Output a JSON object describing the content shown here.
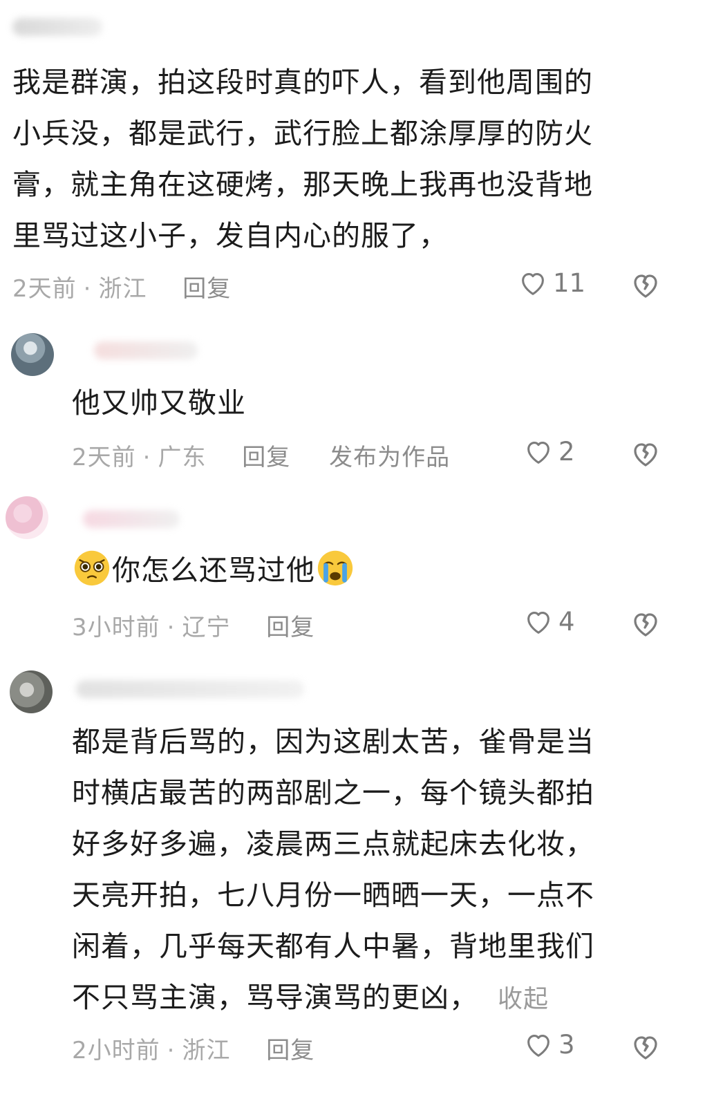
{
  "comments": [
    {
      "lines": [
        "我是群演，拍这段时真的吓人，看到他周围的",
        "小兵没，都是武行，武行脸上都涂厚厚的防火",
        "膏，就主角在这硬烤，那天晚上我再也没背地",
        "里骂过这小子，发自内心的服了，"
      ],
      "time": "2天前",
      "location": "浙江",
      "reply": "回复",
      "likes": "11"
    },
    {
      "text": "他又帅又敬业",
      "time": "2天前",
      "location": "广东",
      "reply": "回复",
      "publish": "发布为作品",
      "likes": "2"
    },
    {
      "text": "你怎么还骂过他",
      "leading_emoji": "pleading-face-emoji",
      "trailing_emoji": "crying-face-emoji",
      "time": "3小时前",
      "location": "辽宁",
      "reply": "回复",
      "likes": "4"
    },
    {
      "lines": [
        "都是背后骂的，因为这剧太苦，雀骨是当",
        "时横店最苦的两部剧之一，每个镜头都拍",
        "好多好多遍，凌晨两三点就起床去化妆，",
        "天亮开拍，七八月份一晒晒一天，一点不",
        "闲着，几乎每天都有人中暑，背地里我们",
        "不只骂主演，骂导演骂的更凶，"
      ],
      "collapse": "收起",
      "time": "2小时前",
      "location": "浙江",
      "reply": "回复",
      "likes": "3"
    }
  ],
  "icons": {
    "like": "heart-outline-icon",
    "dislike": "broken-heart-icon"
  },
  "colors": {
    "text": "#1c1c1c",
    "meta": "#a8a8a8",
    "icon": "#7c7c7c"
  }
}
